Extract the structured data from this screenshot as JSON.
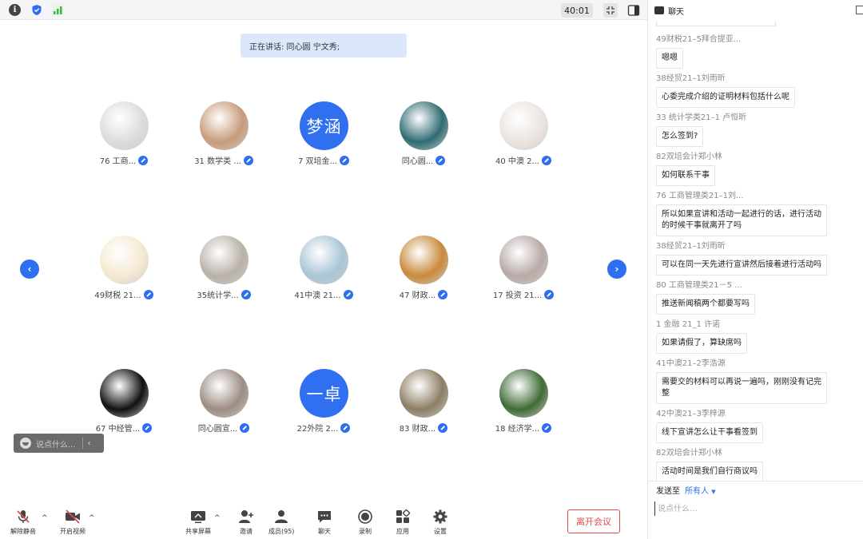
{
  "topbar": {
    "timer": "40:01",
    "info_icon": "i"
  },
  "speaking": {
    "text": "正在讲话: 同心圆 宁文秀;"
  },
  "participants": [
    {
      "label": "76 工商...",
      "avatar": "image",
      "color": "#dcdcdc"
    },
    {
      "label": "31 数学类 ...",
      "avatar": "image",
      "color": "#c89b7b"
    },
    {
      "label": "7 双培金...",
      "avatar": "text",
      "text": "梦涵",
      "color": "#2f6ff0"
    },
    {
      "label": "同心圆...",
      "avatar": "image",
      "color": "#2f6b73"
    },
    {
      "label": "40 中澳 2...",
      "avatar": "image",
      "color": "#ece4df"
    },
    {
      "label": "49财税 21...",
      "avatar": "image",
      "color": "#f5e9d2"
    },
    {
      "label": "35统计学...",
      "avatar": "image",
      "color": "#b9b2a8"
    },
    {
      "label": "41中澳 21...",
      "avatar": "image",
      "color": "#a9c6d6"
    },
    {
      "label": "47 财政...",
      "avatar": "image",
      "color": "#c98a3c"
    },
    {
      "label": "17 投资 21...",
      "avatar": "image",
      "color": "#b8a9a6"
    },
    {
      "label": "67 中经管...",
      "avatar": "image",
      "color": "#111111"
    },
    {
      "label": "同心圆宣...",
      "avatar": "image",
      "color": "#9c8d83"
    },
    {
      "label": "22外院 2...",
      "avatar": "text",
      "text": "一卓",
      "color": "#2f6ff0"
    },
    {
      "label": "83 财政...",
      "avatar": "image",
      "color": "#8c7e64"
    },
    {
      "label": "18 经济学...",
      "avatar": "image",
      "color": "#3f6b35"
    }
  ],
  "reaction_bar": {
    "placeholder": "说点什么..."
  },
  "toolbar": {
    "unmute": "解除静音",
    "start_video": "开启视频",
    "share_screen": "共享屏幕",
    "invite": "邀请",
    "members": "成员(95)",
    "chat": "聊天",
    "record": "录制",
    "apps": "应用",
    "settings": "设置",
    "leave": "离开会议"
  },
  "chat": {
    "title": "聊天",
    "messages": [
      {
        "sender": "49财税21–5拜合提亚...",
        "text": "嗯嗯"
      },
      {
        "sender": "38经贸21–1刘雨昕",
        "text": "心委完成介绍的证明材料包括什么呢"
      },
      {
        "sender": "33 统计学类21–1 卢恒昕",
        "text": "怎么签到?"
      },
      {
        "sender": "82双培会计郑小林",
        "text": "如何联系干事"
      },
      {
        "sender": "76 工商管理类21–1刘...",
        "text": "所以如果宣讲和活动一起进行的话，进行活动的时候干事就离开了吗"
      },
      {
        "sender": "38经贸21–1刘雨昕",
        "text": "可以在同一天先进行宣讲然后接着进行活动吗"
      },
      {
        "sender": "80 工商管理类21－5 ...",
        "text": "推送新闻稿两个都要写吗"
      },
      {
        "sender": "1 金融 21_1 许诺",
        "text": "如果请假了，算缺席吗"
      },
      {
        "sender": "41中澳21–2李浩源",
        "text": "需要交的材料可以再说一遍吗，刚刚没有记完整"
      },
      {
        "sender": "42中澳21–3李梓源",
        "text": "线下宣讲怎么让干事看签到"
      },
      {
        "sender": "82双培会计郑小林",
        "text": "活动时间是我们自行商议吗"
      }
    ],
    "send_to_label": "发送至",
    "send_to_target": "所有人",
    "input_placeholder": "说点什么..."
  },
  "colors": {
    "accent": "#2d6ff0",
    "leave": "#e24b4b",
    "speaking_bg": "#dbe8fb"
  }
}
